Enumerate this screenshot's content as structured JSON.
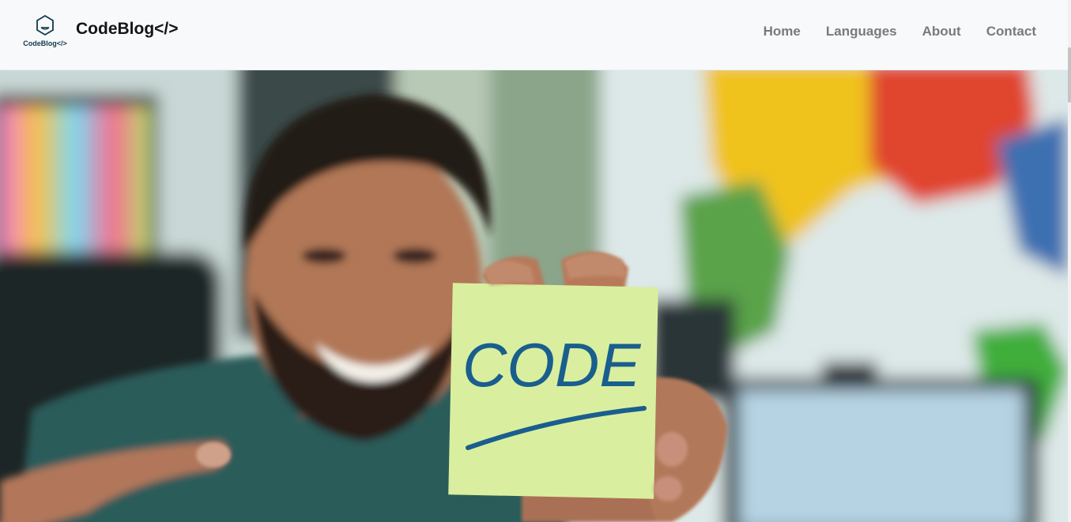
{
  "brand": {
    "logo_text": "CodeBlog</>",
    "name": "CodeBlog</>",
    "accent_color": "#0f3b4a"
  },
  "nav": {
    "items": [
      {
        "label": "Home"
      },
      {
        "label": "Languages"
      },
      {
        "label": "About"
      },
      {
        "label": "Contact"
      }
    ],
    "link_color": "#777a7e"
  },
  "hero": {
    "note_text": "CODE",
    "note_color": "#d9ef9f",
    "ink_color": "#1a5e8e"
  }
}
